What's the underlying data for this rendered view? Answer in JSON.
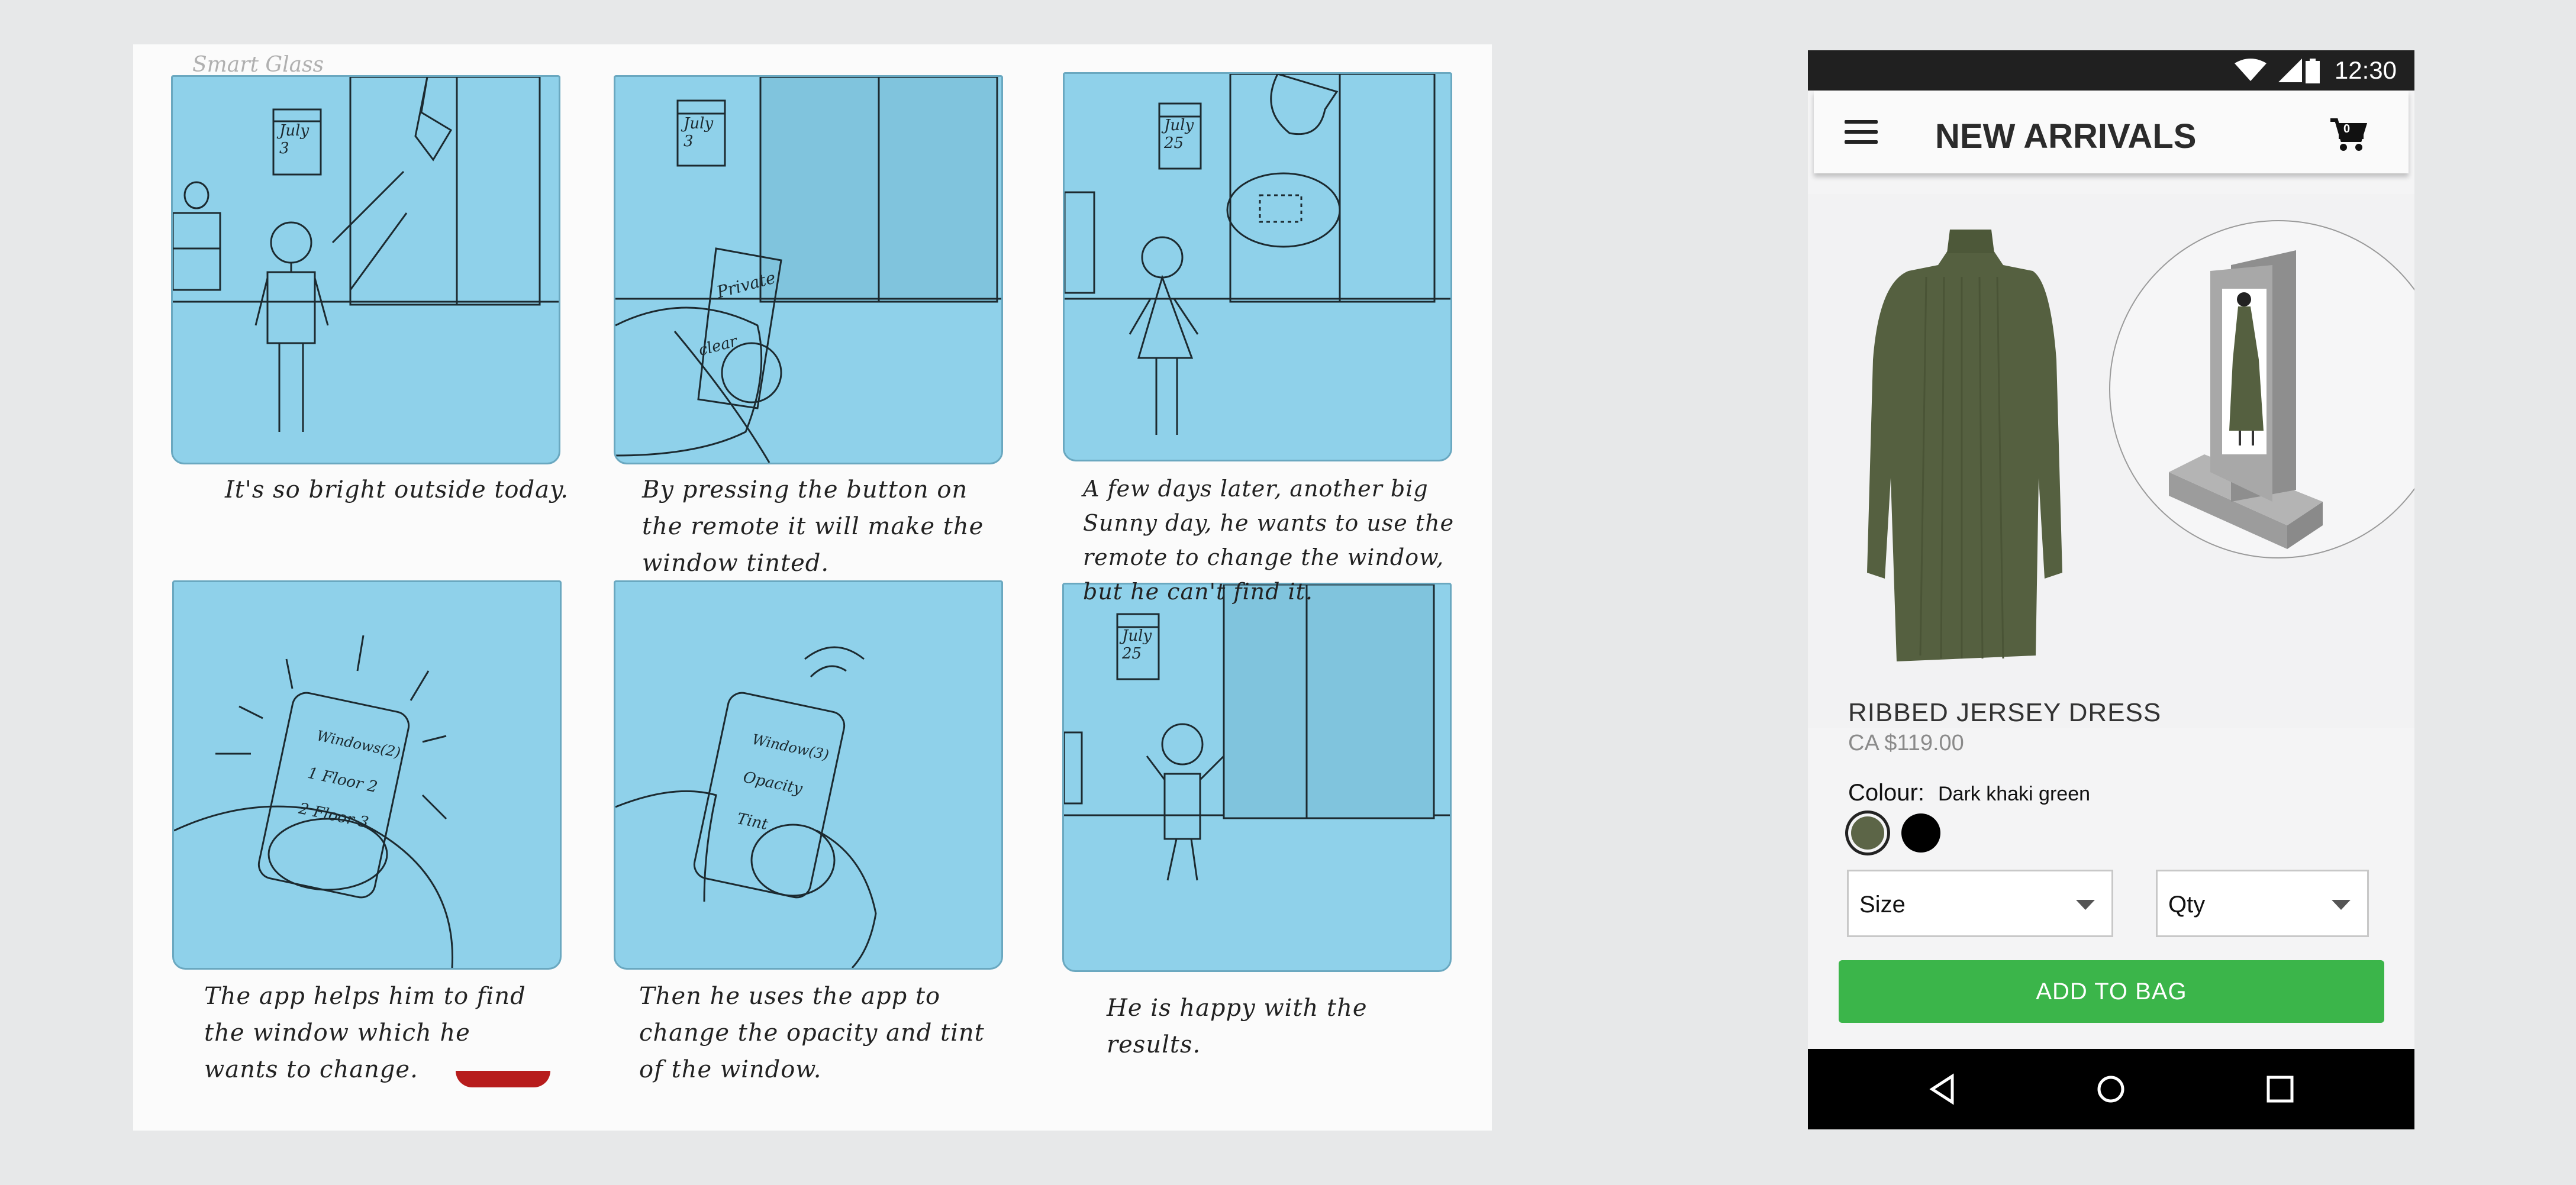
{
  "storyboard": {
    "title": "Smart Glass",
    "captions": [
      "It's so bright outside today.",
      "By pressing the button on the remote it will make the window tinted.",
      "A few days later, another big Sunny day, he wants to use the remote to change the window, but he can't find it.",
      "The app helps him to find the window which he wants to change.",
      "Then he uses the app to change the opacity and tint of the window.",
      "He is happy with the results."
    ],
    "sketch_text": {
      "calendar_1": "July 3",
      "calendar_2": "July 3",
      "calendar_3": "July 25",
      "calendar_6": "July 25",
      "remote_label_1": "Private",
      "remote_label_2": "clear",
      "phone4_line1": "Windows(2)",
      "phone4_line2": "1 Floor 2",
      "phone4_line3": "2 Floor 3",
      "phone5_line1": "Window(3)",
      "phone5_line2": "Opacity",
      "phone5_line3": "Tint"
    }
  },
  "phone": {
    "status_time": "12:30",
    "app_title": "NEW ARRIVALS",
    "cart_count": "0",
    "product_name": "RIBBED JERSEY DRESS",
    "product_price": "CA $119.00",
    "colour_label": "Colour:",
    "colour_value": "Dark khaki green",
    "swatches": [
      "#5c6547",
      "#000000"
    ],
    "size_label": "Size",
    "qty_label": "Qty",
    "add_button": "ADD TO BAG",
    "accent_color": "#3bb54a"
  }
}
